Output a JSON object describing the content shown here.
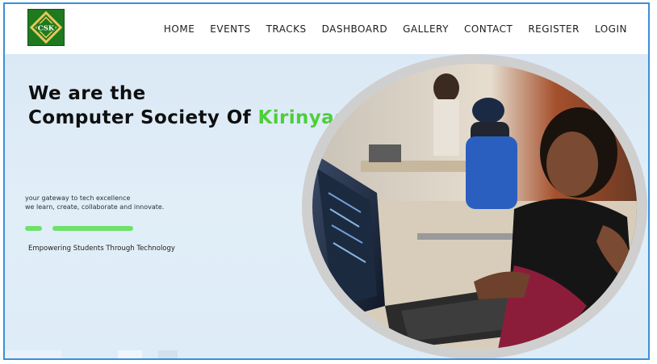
{
  "brand": {
    "logo_text": "CSK"
  },
  "nav": {
    "items": [
      "HOME",
      "EVENTS",
      "TRACKS",
      "DASHBOARD",
      "GALLERY",
      "CONTACT",
      "REGISTER",
      "LOGIN"
    ]
  },
  "hero": {
    "headline_line1": "We are the",
    "headline_line2_prefix": "Computer Society Of ",
    "headline_line2_accent": "Kirinyaga",
    "tagline_line1": "your gateway to tech excellence",
    "tagline_line2": "we learn,  create, collaborate and innovate.",
    "slogan": "Empowering Students Through Technology"
  },
  "colors": {
    "accent_green": "#4ccf3a",
    "pill_green": "#6fe16a",
    "logo_green": "#1f7a1f",
    "frame_blue": "#3b8fd9",
    "hero_bg": "#dbe9f6"
  }
}
